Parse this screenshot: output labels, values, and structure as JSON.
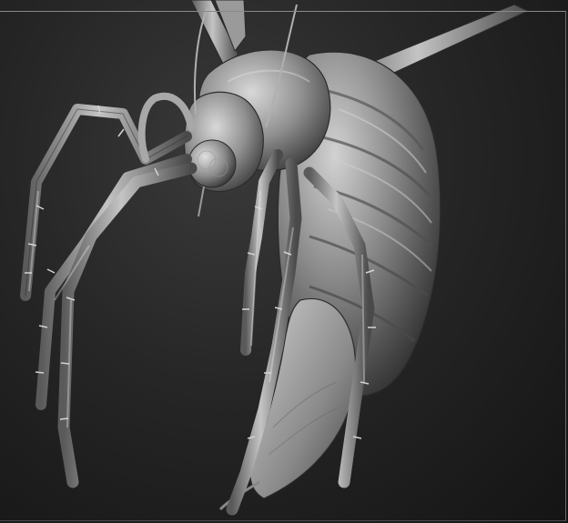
{
  "app": {
    "view": "3d-sculpt-viewport"
  },
  "viewport": {
    "background_top": "#3a3a3a",
    "background_bottom": "#141414",
    "frame_color": "#8a8a8a",
    "material_light": "#c8c8c8",
    "material_mid": "#8c8c8c",
    "material_dark": "#3c3c3c"
  },
  "model": {
    "subject": "insect-sculpt",
    "parts": [
      "head",
      "compound-eyes",
      "antennae",
      "thorax",
      "abdomen",
      "stinger",
      "wings",
      "legs"
    ]
  }
}
